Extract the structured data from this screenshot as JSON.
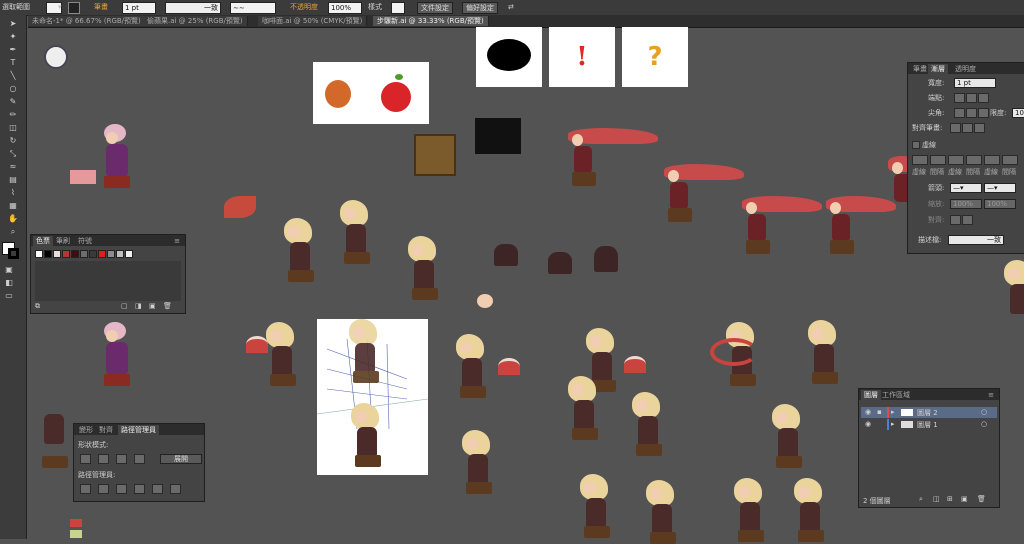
{
  "control_bar": {
    "selection_label": "選取範圍",
    "stroke_label": "筆畫",
    "stroke_weight": "1 pt",
    "uniform_label": "一致",
    "opacity_label": "不透明度",
    "opacity_value": "100%",
    "style_label": "樣式",
    "document_setup": "文件設定",
    "preferences": "偏好設定"
  },
  "tabs": [
    {
      "label": "未命名-1* @ 66.67% (RGB/預覽)"
    },
    {
      "label": "偷蘋果.ai @ 25% (RGB/預覽)"
    },
    {
      "label": "咖啡面.ai @ 50% (CMYK/預覽)"
    },
    {
      "label": "步驟新.ai @ 33.33% (RGB/預覽)"
    }
  ],
  "artboards": {
    "exclamation": "!",
    "question": "?"
  },
  "stroke_panel": {
    "tabs": [
      "筆畫",
      "漸層",
      "透明度"
    ],
    "weight_label": "寬度:",
    "weight_value": "1 pt",
    "cap_label": "端點:",
    "corner_label": "尖角:",
    "limit_label": "限度:",
    "limit_value": "10",
    "align_label": "對齊筆畫:",
    "dashed_label": "虛線",
    "dash_labels": [
      "虛線",
      "間隔",
      "虛線",
      "間隔",
      "虛線",
      "間隔"
    ],
    "arrowhead_label": "箭頭:",
    "scale_label": "縮放:",
    "scale_value_1": "100%",
    "scale_value_2": "100%",
    "align_arrow_label": "對齊:",
    "profile_label": "描述檔:",
    "profile_value": "一致"
  },
  "swatches_panel": {
    "tabs": [
      "色票",
      "筆刷",
      "符號"
    ],
    "swatch_colors": [
      "#ffffff",
      "#000000",
      "#e6dede",
      "#b7362f",
      "#3b0f10",
      "#6d6d6d",
      "#3a3a3a",
      "#e11d1d",
      "#8c8c8c",
      "#c0c0c0",
      "#f0f0f0"
    ]
  },
  "pathfinder_panel": {
    "tabs": [
      "變形",
      "對齊",
      "路徑管理員"
    ],
    "shape_modes_label": "形狀模式:",
    "expand_label": "展開",
    "pathfinders_label": "路徑管理員:"
  },
  "layers_panel": {
    "tabs": [
      "圖層",
      "工作區域"
    ],
    "layers": [
      {
        "name": "圖層 2",
        "color": "#e34a4a"
      },
      {
        "name": "圖層 1",
        "color": "#4a7ee3"
      }
    ],
    "count_label": "2 個圖層"
  }
}
